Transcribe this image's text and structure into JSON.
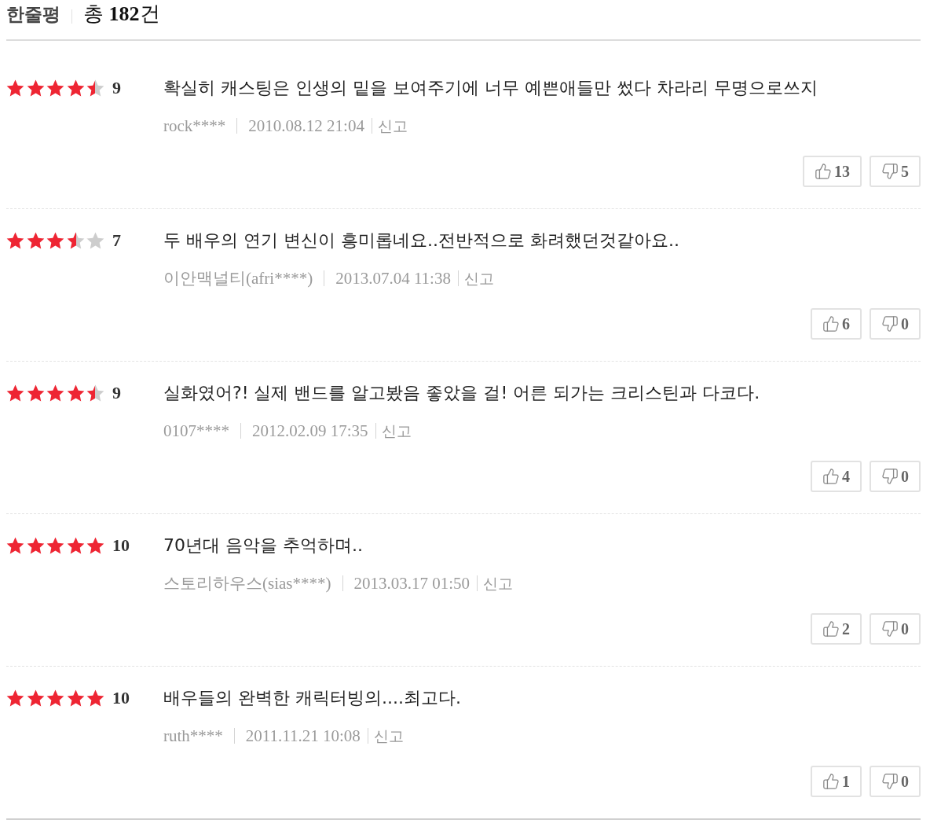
{
  "header": {
    "title": "한줄평",
    "total": "총 **182**건"
  },
  "reviews": [
    {
      "stars": 4.5,
      "score": "9",
      "comment": "확실히 캐스팅은 인생의 밑을 보여주기에 너무 예쁜애들만 썼다 차라리 무명으로쓰지",
      "author": "rock****",
      "date": "2010.08.12 21:04",
      "report": "신고",
      "likes": "13",
      "dislikes": "5"
    },
    {
      "stars": 3.5,
      "score": "7",
      "comment": "두 배우의 연기 변신이 흥미롭네요..전반적으로 화려했던것같아요..",
      "author": "이안맥널티(afri****)",
      "date": "2013.07.04 11:38",
      "report": "신고",
      "likes": "6",
      "dislikes": "0"
    },
    {
      "stars": 4.5,
      "score": "9",
      "comment": "실화였어?! 실제 밴드를 알고봤음 좋았을 걸! 어른 되가는 크리스틴과 다코다.",
      "author": "0107****",
      "date": "2012.02.09 17:35",
      "report": "신고",
      "likes": "4",
      "dislikes": "0"
    },
    {
      "stars": 5,
      "score": "10",
      "comment": "70년대 음악을 추억하며..",
      "author": "스토리하우스(sias****)",
      "date": "2013.03.17 01:50",
      "report": "신고",
      "likes": "2",
      "dislikes": "0"
    },
    {
      "stars": 5,
      "score": "10",
      "comment": "배우들의 완벽한 캐릭터빙의....최고다.",
      "author": "ruth****",
      "date": "2011.11.21 10:08",
      "report": "신고",
      "likes": "1",
      "dislikes": "0"
    }
  ]
}
